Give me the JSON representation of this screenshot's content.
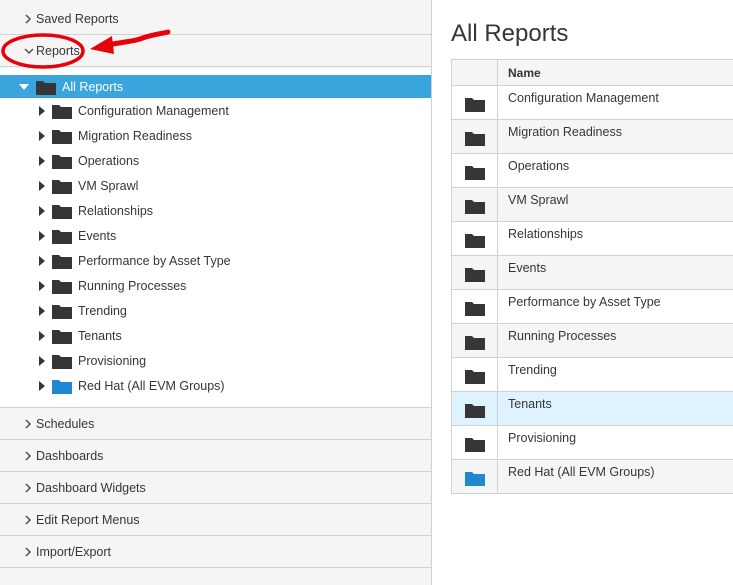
{
  "accordion": {
    "saved_reports": "Saved Reports",
    "reports": "Reports",
    "schedules": "Schedules",
    "dashboards": "Dashboards",
    "dashboard_widgets": "Dashboard Widgets",
    "edit_report_menus": "Edit Report Menus",
    "import_export": "Import/Export"
  },
  "tree": {
    "root": "All Reports",
    "items": [
      {
        "label": "Configuration Management",
        "icon": "folder-icon"
      },
      {
        "label": "Migration Readiness",
        "icon": "folder-icon"
      },
      {
        "label": "Operations",
        "icon": "folder-icon"
      },
      {
        "label": "VM Sprawl",
        "icon": "folder-icon"
      },
      {
        "label": "Relationships",
        "icon": "folder-icon"
      },
      {
        "label": "Events",
        "icon": "folder-icon"
      },
      {
        "label": "Performance by Asset Type",
        "icon": "folder-icon"
      },
      {
        "label": "Running Processes",
        "icon": "folder-icon"
      },
      {
        "label": "Trending",
        "icon": "folder-icon"
      },
      {
        "label": "Tenants",
        "icon": "folder-icon"
      },
      {
        "label": "Provisioning",
        "icon": "folder-icon"
      },
      {
        "label": "Red Hat (All EVM Groups)",
        "icon": "blue-folder-icon"
      }
    ]
  },
  "main": {
    "title": "All Reports",
    "table": {
      "header": "Name",
      "rows": [
        "Configuration Management",
        "Migration Readiness",
        "Operations",
        "VM Sprawl",
        "Relationships",
        "Events",
        "Performance by Asset Type",
        "Running Processes",
        "Trending",
        "Tenants",
        "Provisioning",
        "Red Hat (All EVM Groups)"
      ]
    }
  },
  "colors": {
    "selected": "#39a5dc",
    "folder_dark": "#363636",
    "folder_blue": "#1e88d1",
    "annotation_red": "#e8000b",
    "row_highlight": "#def3ff"
  }
}
